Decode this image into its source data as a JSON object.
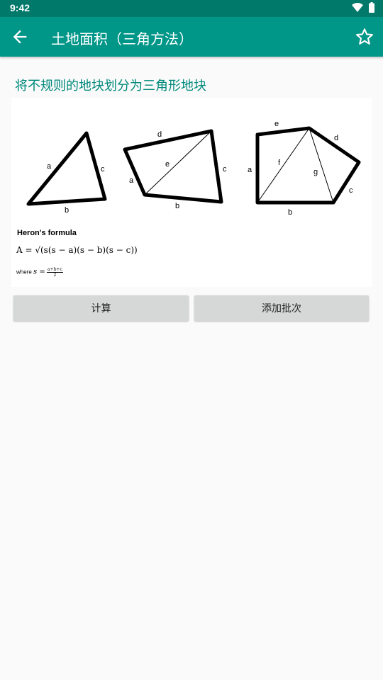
{
  "status": {
    "time": "9:42"
  },
  "appbar": {
    "title": "土地面积（三角方法）"
  },
  "heading": "将不规则的地块划分为三角形地块",
  "diagram": {
    "labels": {
      "tri_a": "a",
      "tri_b": "b",
      "tri_c": "c",
      "quad_d": "d",
      "quad_e": "e",
      "quad_a": "a",
      "quad_b": "b",
      "quad_c": "c",
      "pent_e": "e",
      "pent_d": "d",
      "pent_a": "a",
      "pent_f": "f",
      "pent_g": "g",
      "pent_b": "b",
      "pent_c": "c"
    },
    "heron_title": "Heron's formula",
    "formula": "A = √(s(s − a)(s − b)(s − c))",
    "where_label": "where",
    "s_def": "s =",
    "s_num": "a+b+c",
    "s_den": "2"
  },
  "buttons": {
    "calculate": "计算",
    "add_batch": "添加批次"
  }
}
